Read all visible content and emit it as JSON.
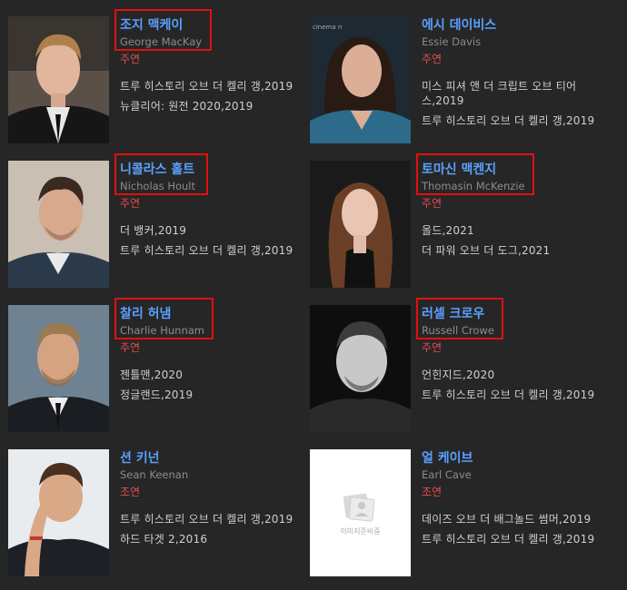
{
  "cast": [
    {
      "name": "조지 맥케이",
      "ename": "George MacKay",
      "role": "주연",
      "works": [
        "트루 히스토리 오브 더 켈리 갱,2019",
        "뉴클리어: 원전 2020,2019"
      ]
    },
    {
      "name": "에시 데이비스",
      "ename": "Essie Davis",
      "role": "주연",
      "works": [
        "미스 피셔 앤 더 크립트 오브 티어",
        "스,2019",
        "트루 히스토리 오브 더 켈리 갱,2019"
      ]
    },
    {
      "name": "니콜라스 홀트",
      "ename": "Nicholas Hoult",
      "role": "주연",
      "works": [
        "더 뱅커,2019",
        "트루 히스토리 오브 더 켈리 갱,2019"
      ]
    },
    {
      "name": "토마신 맥켄지",
      "ename": "Thomasin McKenzie",
      "role": "주연",
      "works": [
        "올드,2021",
        "더 파워 오브 더 도그,2021"
      ]
    },
    {
      "name": "찰리 허냄",
      "ename": "Charlie Hunnam",
      "role": "주연",
      "works": [
        "젠틀맨,2020",
        "정글랜드,2019"
      ]
    },
    {
      "name": "러셀 크로우",
      "ename": "Russell Crowe",
      "role": "주연",
      "works": [
        "언힌지드,2020",
        "트루 히스토리 오브 더 켈리 갱,2019"
      ]
    },
    {
      "name": "션 키넌",
      "ename": "Sean Keenan",
      "role": "조연",
      "works": [
        "트루 히스토리 오브 더 켈리 갱,2019",
        "하드 타겟 2,2016"
      ]
    },
    {
      "name": "얼 케이브",
      "ename": "Earl Cave",
      "role": "조연",
      "works": [
        "데이즈 오브 더 배그놀드 썸머,2019",
        "트루 히스토리 오브 더 켈리 갱,2019"
      ]
    }
  ],
  "no_image_label": "이미지준비중",
  "colors": {
    "name": "#5aa0ff",
    "ename": "#8c8c8c",
    "role": "#e74c4c",
    "work": "#cfcfcf",
    "highlight": "#e01010",
    "background": "#262626"
  },
  "highlighted_names": [
    "조지 맥케이",
    "니콜라스 홀트",
    "토마신 맥켄지",
    "찰리 허냄",
    "러셀 크로우"
  ]
}
